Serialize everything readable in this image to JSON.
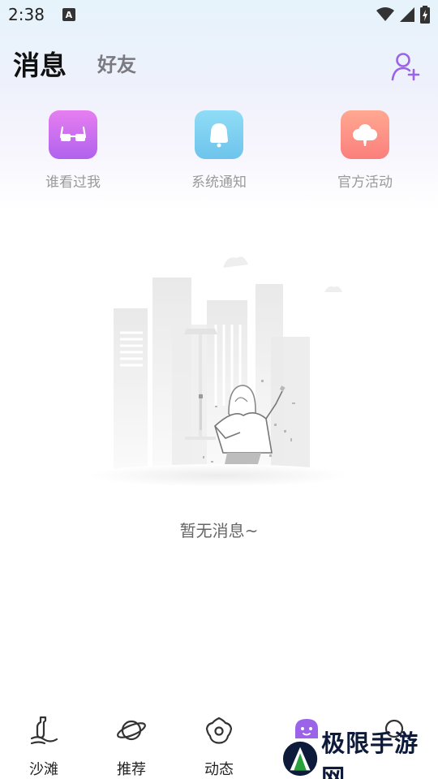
{
  "status_bar": {
    "time": "2:38",
    "notification_icon": "a-letter-icon",
    "icons": [
      "wifi-icon",
      "signal-icon",
      "battery-charging-icon"
    ]
  },
  "header": {
    "tabs": [
      {
        "label": "消息",
        "active": true
      },
      {
        "label": "好友",
        "active": false
      }
    ],
    "add_friend_icon": "add-user-icon",
    "accent_color": "#9b63e8"
  },
  "shortcuts": [
    {
      "label": "谁看过我",
      "icon": "glasses-icon",
      "colors": [
        "#e77ef0",
        "#b062ee"
      ]
    },
    {
      "label": "系统通知",
      "icon": "bell-icon",
      "colors": [
        "#8fdcf6",
        "#6ec4ec"
      ]
    },
    {
      "label": "官方活动",
      "icon": "cloud-icon",
      "colors": [
        "#ffa891",
        "#fb7f7c"
      ]
    }
  ],
  "empty_state": {
    "illustration": "city-woman-empty-illustration",
    "text": "暂无消息~"
  },
  "bottom_nav": [
    {
      "label": "沙滩",
      "icon": "beach-bottle-icon",
      "active": false
    },
    {
      "label": "推荐",
      "icon": "planet-icon",
      "active": false
    },
    {
      "label": "动态",
      "icon": "flower-icon",
      "active": false
    },
    {
      "label": "",
      "icon": "ghost-face-icon",
      "active": true
    },
    {
      "label": "",
      "icon": "circle-icon",
      "active": false
    }
  ],
  "watermark": {
    "text": "极限手游网",
    "logo": "triangle-logo-icon"
  }
}
